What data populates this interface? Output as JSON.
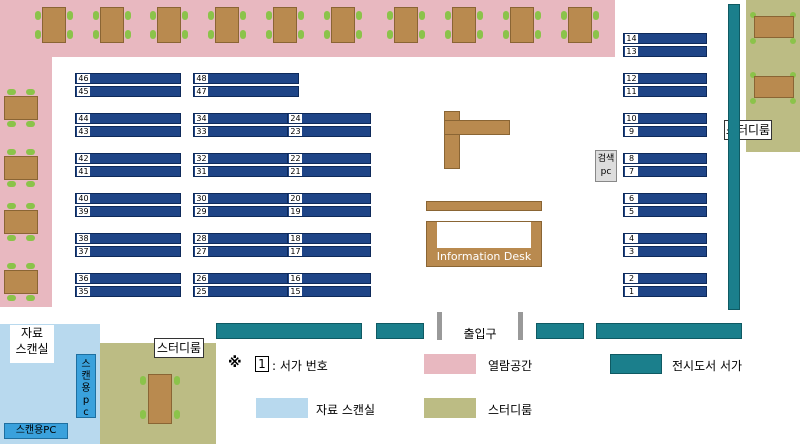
{
  "rooms": {
    "study_top_right": "스터디룸",
    "study_bottom_left": "스터디룸",
    "scan_room": "자료\n스캔실",
    "scan_pc_vertical": "스캔용pc",
    "scan_pc_horizontal": "스캔용PC",
    "search_pc": "검색\npc",
    "info_desk": "Information Desk",
    "entrance": "출입구"
  },
  "legend": {
    "mark": "※",
    "shelf_num_label": "1",
    "shelf_num_text": ": 서가 번호",
    "reading": "열람공간",
    "display": "전시도서 서가",
    "scan": "자료 스캔실",
    "study": "스터디룸"
  },
  "shelves": {
    "col1": [
      [
        "46",
        "45"
      ],
      [
        "44",
        "43"
      ],
      [
        "42",
        "41"
      ],
      [
        "40",
        "39"
      ],
      [
        "38",
        "37"
      ],
      [
        "36",
        "35"
      ]
    ],
    "col2": [
      [
        "48",
        "47"
      ],
      [
        "34",
        "33"
      ],
      [
        "32",
        "31"
      ],
      [
        "30",
        "29"
      ],
      [
        "28",
        "27"
      ],
      [
        "26",
        "25"
      ]
    ],
    "col3": [
      [
        "24",
        "23"
      ],
      [
        "22",
        "21"
      ],
      [
        "20",
        "19"
      ],
      [
        "18",
        "17"
      ],
      [
        "16",
        "15"
      ]
    ],
    "col4": [
      [
        "14",
        "13"
      ],
      [
        "12",
        "11"
      ],
      [
        "10",
        "9"
      ],
      [
        "8",
        "7"
      ],
      [
        "6",
        "5"
      ],
      [
        "4",
        "3"
      ],
      [
        "2",
        "1"
      ]
    ]
  },
  "colors": {
    "reading": "#e8b8c0",
    "scan": "#b8d9ee",
    "study": "#bcbc84",
    "shelf": "#1f4587",
    "display": "#1b7f8c",
    "desk": "#b98a4f",
    "chair": "#8bc34a"
  }
}
